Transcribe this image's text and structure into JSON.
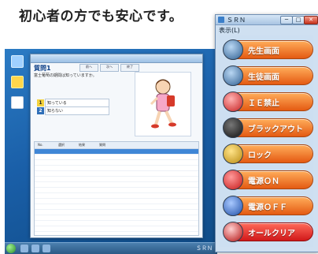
{
  "headline": "初心者の方でも安心です。",
  "colors": {
    "panel_bg": "#cfe0f1",
    "button_orange": "#f07a2a",
    "button_red": "#d1181a",
    "desktop_blue": "#1a5fa8"
  },
  "desktop": {
    "icons": [
      "computer-icon",
      "folder-icon",
      "recycle-bin-icon"
    ],
    "tray_text": "ＳＲＮ"
  },
  "quiz_window": {
    "title": "質問1",
    "question": "富士葡萄の期間は知っていますか。",
    "buttons": [
      "前へ",
      "次へ",
      "終了"
    ],
    "answers": [
      {
        "num": "1",
        "label": "知っている"
      },
      {
        "num": "2",
        "label": "知らない"
      }
    ],
    "list_headers": [
      "No.",
      "選択",
      "結果",
      "質問"
    ]
  },
  "srn_panel": {
    "title": "ＳＲＮ",
    "menu": "表示(L)",
    "window_buttons": {
      "minimize": "─",
      "maximize": "□",
      "close": "✕"
    },
    "buttons": [
      {
        "label": "先生画面",
        "icon": "teacher-screen-icon"
      },
      {
        "label": "生徒画面",
        "icon": "student-screen-icon"
      },
      {
        "label": "ＩＥ禁止",
        "icon": "ie-block-icon"
      },
      {
        "label": "ブラックアウト",
        "icon": "blackout-icon"
      },
      {
        "label": "ロック",
        "icon": "lock-icon"
      },
      {
        "label": "電源ＯＮ",
        "icon": "power-on-icon"
      },
      {
        "label": "電源ＯＦＦ",
        "icon": "power-off-icon"
      },
      {
        "label": "オールクリア",
        "icon": "all-clear-icon"
      }
    ]
  }
}
